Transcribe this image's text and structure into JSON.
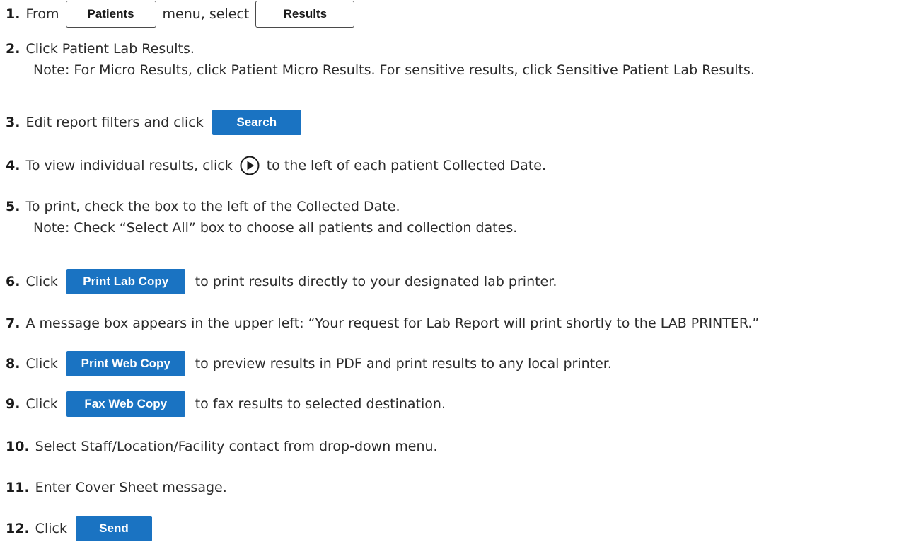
{
  "steps": [
    {
      "num": "1.",
      "pre": "From",
      "btn1": "Patients",
      "mid": "menu, select",
      "btn2": "Results"
    },
    {
      "num": "2.",
      "text": "Click Patient Lab Results.",
      "note": "Note: For Micro Results, click Patient Micro Results.  For sensitive results, click Sensitive Patient Lab Results."
    },
    {
      "num": "3.",
      "text": "Edit report filters and click",
      "btn": "Search"
    },
    {
      "num": "4.",
      "pre": "To view individual results, click",
      "post": "to the left of each patient Collected Date.",
      "icon": "play-circle-icon"
    },
    {
      "num": "5.",
      "text": "To print, check the box to the left of the Collected Date.",
      "note": "Note: Check “Select All” box to choose all patients and collection dates."
    },
    {
      "num": "6.",
      "pre": "Click",
      "btn": "Print Lab Copy",
      "post": "to print results directly to your designated lab printer."
    },
    {
      "num": "7.",
      "text": "A message box appears in the upper left:  “Your request for Lab Report will print shortly to the LAB PRINTER.”"
    },
    {
      "num": "8.",
      "pre": "Click",
      "btn": "Print Web Copy",
      "post": "to preview results in PDF and print results to any local printer."
    },
    {
      "num": "9.",
      "pre": "Click",
      "btn": "Fax Web Copy",
      "post": "to fax results to selected destination."
    },
    {
      "num": "10.",
      "text": "Select Staff/Location/Facility contact from drop-down menu."
    },
    {
      "num": "11.",
      "text": "Enter Cover Sheet message."
    },
    {
      "num": "12.",
      "pre": "Click",
      "btn": "Send"
    }
  ],
  "colors": {
    "accent": "#1a73c2",
    "text": "#2b2b2b"
  }
}
